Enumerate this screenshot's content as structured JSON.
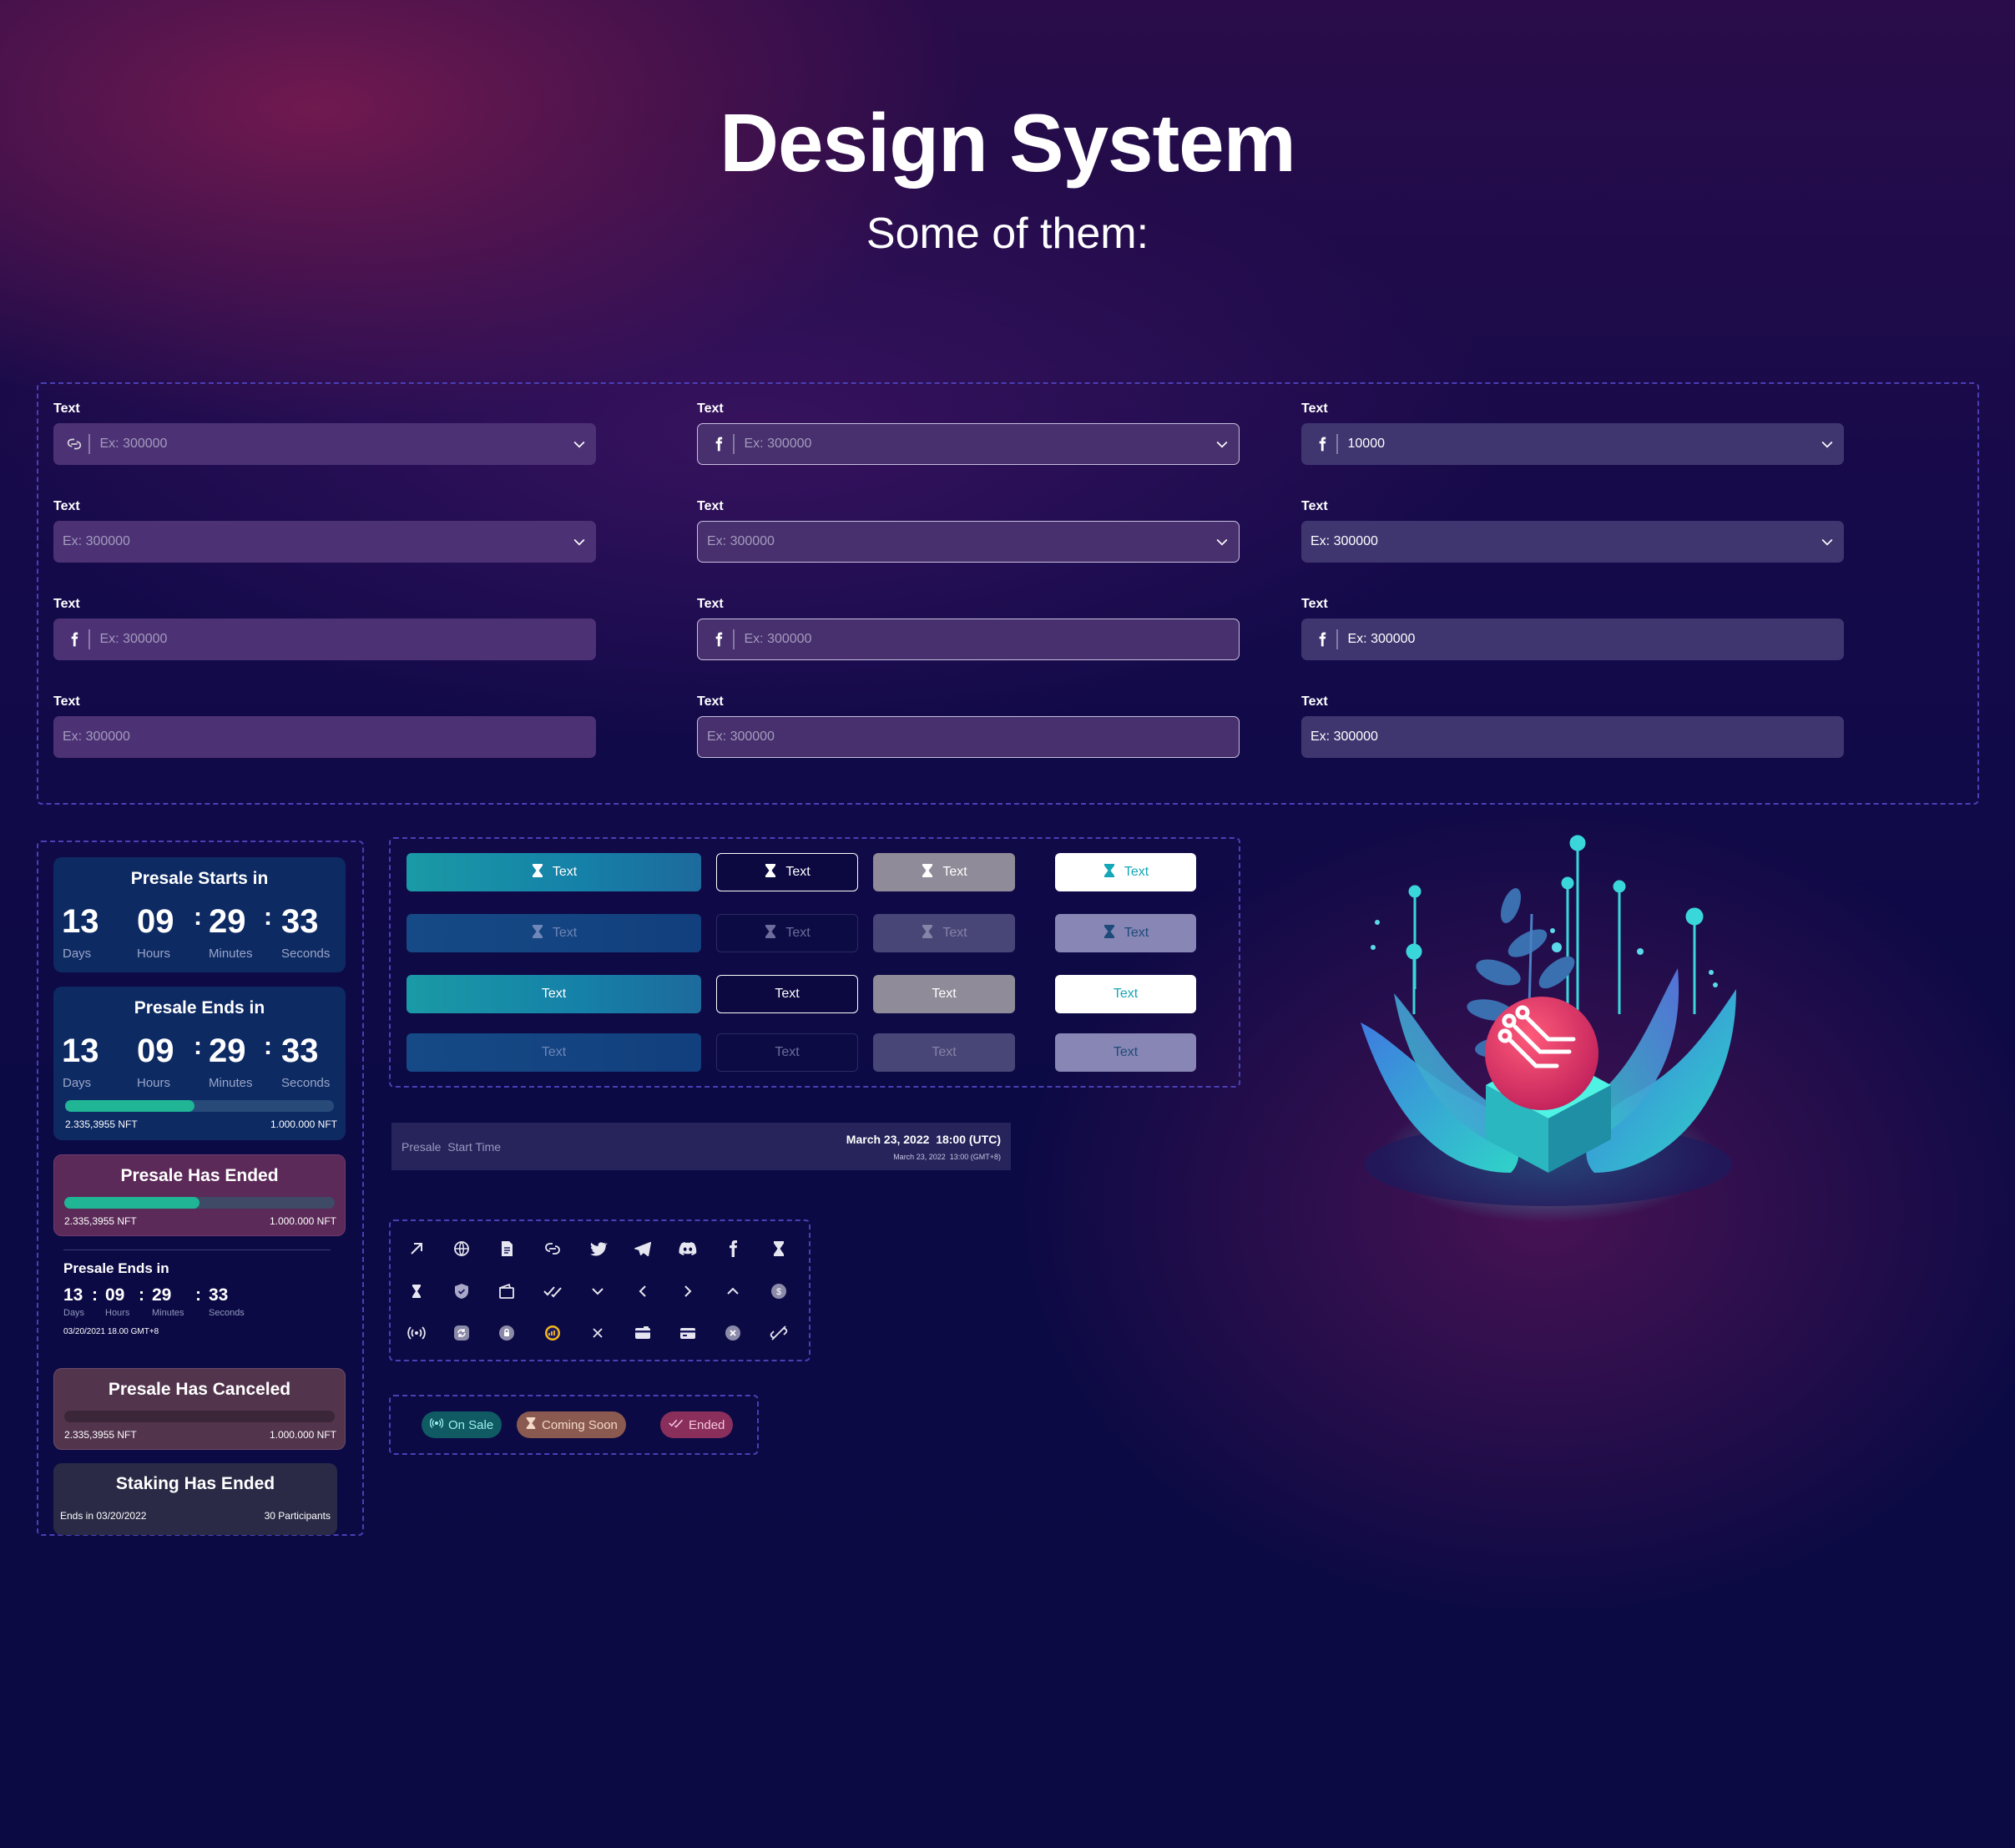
{
  "header": {
    "title": "Design System",
    "subtitle": "Some of them:"
  },
  "fields": {
    "label": "Text",
    "placeholder": "Ex: 300000",
    "filled_value": "Ex: 300000",
    "dropdown_value": "10000"
  },
  "countdown": {
    "starts_title": "Presale Starts in",
    "ends_title": "Presale Ends in",
    "days": "13",
    "hours": "09",
    "minutes": "29",
    "seconds": "33",
    "days_label": "Days",
    "hours_label": "Hours",
    "minutes_label": "Minutes",
    "seconds_label": "Seconds",
    "progress_left": "2.335,3955 NFT",
    "progress_right": "1.000.000 NFT",
    "progress_fraction": 0.48
  },
  "ended": {
    "title": "Presale Has Ended",
    "progress_left": "2.335,3955 NFT",
    "progress_right": "1.000.000 NFT",
    "progress_fraction": 0.5
  },
  "compact": {
    "title": "Presale Ends in",
    "days": "13",
    "hours": "09",
    "minutes": "29",
    "seconds": "33",
    "days_label": "Days",
    "hours_label": "Hours",
    "minutes_label": "Minutes",
    "seconds_label": "Seconds",
    "date": "03/20/2021 18.00 GMT+8"
  },
  "canceled": {
    "title": "Presale Has Canceled",
    "progress_left": "2.335,3955 NFT",
    "progress_right": "1.000.000 NFT"
  },
  "staking": {
    "title": "Staking Has Ended",
    "ends": "Ends in 03/20/2022",
    "participants": "30 Participants"
  },
  "buttons": {
    "label": "Text"
  },
  "presale_time": {
    "label": "Presale  Start Time",
    "utc": "March 23, 2022  18:00 (UTC)",
    "local": "March 23, 2022  13:00 (GMT+8)"
  },
  "icons": [
    "arrow-up-right-icon",
    "globe-icon",
    "document-icon",
    "chain-link-icon",
    "twitter-icon",
    "telegram-icon",
    "discord-icon",
    "facebook-icon",
    "hourglass-icon",
    "hourglass-small-icon",
    "shield-check-icon",
    "wallet-icon",
    "double-check-icon",
    "chevron-down-icon",
    "chevron-left-icon",
    "chevron-right-icon",
    "chevron-up-icon",
    "coin-icon",
    "broadcast-icon",
    "refresh-icon",
    "lock-icon",
    "chart-coin-icon",
    "close-icon",
    "card-icon",
    "card-alt-icon",
    "close-circle-icon",
    "link-broken-icon"
  ],
  "status": {
    "on_sale": "On Sale",
    "coming_soon": "Coming Soon",
    "ended": "Ended"
  },
  "colors": {
    "accent": "#16a6b6",
    "progress": "#1fb595",
    "card_dark": "#0d2a63",
    "card_ended": "#5b2a58",
    "card_canceled": "#52344d",
    "card_staking": "#2a2a46"
  }
}
